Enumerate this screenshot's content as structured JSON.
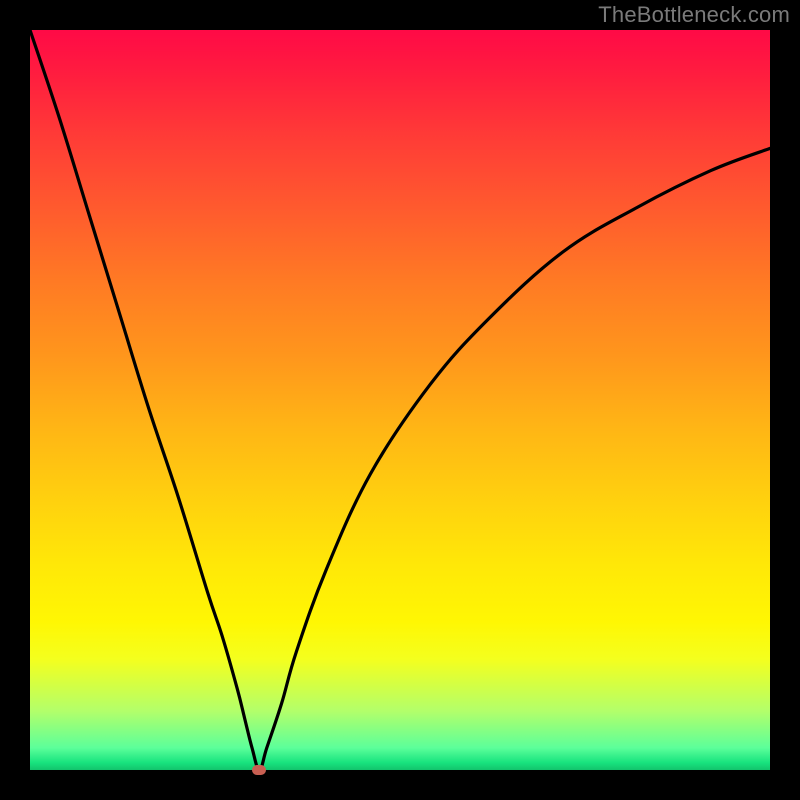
{
  "watermark": "TheBottleneck.com",
  "chart_data": {
    "type": "line",
    "title": "",
    "xlabel": "",
    "ylabel": "",
    "xlim": [
      0,
      100
    ],
    "ylim": [
      0,
      100
    ],
    "grid": false,
    "series": [
      {
        "name": "bottleneck-curve",
        "x": [
          0,
          4,
          8,
          12,
          16,
          20,
          24,
          26,
          28,
          29,
          30,
          31,
          32,
          34,
          36,
          40,
          46,
          54,
          62,
          72,
          82,
          92,
          100
        ],
        "values": [
          100,
          88,
          75,
          62,
          49,
          37,
          24,
          18,
          11,
          7,
          3,
          0,
          3,
          9,
          16,
          27,
          40,
          52,
          61,
          70,
          76,
          81,
          84
        ]
      }
    ],
    "marker": {
      "x": 31,
      "y": 0,
      "color": "#c85f52"
    },
    "background": {
      "type": "vertical-gradient",
      "stops": [
        {
          "pos": 0,
          "color": "#ff0a46"
        },
        {
          "pos": 50,
          "color": "#ff961c"
        },
        {
          "pos": 80,
          "color": "#fff703"
        },
        {
          "pos": 100,
          "color": "#12c46c"
        }
      ]
    }
  }
}
